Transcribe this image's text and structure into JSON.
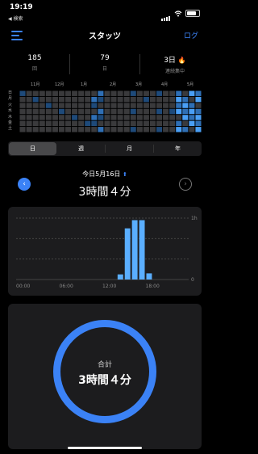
{
  "status": {
    "time": "19:19",
    "back": "◀ 検索"
  },
  "header": {
    "title": "スタッツ",
    "log": "ログ"
  },
  "stats": [
    {
      "value": "185",
      "label": "回"
    },
    {
      "value": "79",
      "label": "日"
    },
    {
      "value": "3日",
      "label": "連続集中"
    }
  ],
  "heatmap": {
    "months": [
      "11月",
      "12月",
      "1月",
      "2月",
      "3月",
      "4月",
      "5月"
    ],
    "days": [
      "日",
      "月",
      "火",
      "水",
      "木",
      "金",
      "土"
    ],
    "colors": {
      "empty": "#3a3a3c",
      "low": "#1e4a7a",
      "mid": "#2f6fb5",
      "high": "#4a9ff5"
    }
  },
  "tabs": [
    "日",
    "週",
    "月",
    "年"
  ],
  "active_tab": "日",
  "day": {
    "date": "今日5月16日",
    "duration": "3時間４分"
  },
  "chart_data": {
    "type": "bar",
    "x_ticks": [
      "00:00",
      "06:00",
      "12:00",
      "18:00"
    ],
    "y_ticks": [
      "1h",
      "0"
    ],
    "ylim": [
      0,
      60
    ],
    "hours": [
      0,
      1,
      2,
      3,
      4,
      5,
      6,
      7,
      8,
      9,
      10,
      11,
      12,
      13,
      14,
      15,
      16,
      17,
      18,
      19,
      20,
      21,
      22,
      23
    ],
    "minutes": [
      0,
      0,
      0,
      0,
      0,
      0,
      0,
      0,
      0,
      0,
      0,
      0,
      0,
      0,
      5,
      50,
      58,
      58,
      6,
      0,
      0,
      0,
      0,
      0
    ]
  },
  "total": {
    "label": "合計",
    "value": "3時間４分"
  },
  "accent": "#3b82f6"
}
